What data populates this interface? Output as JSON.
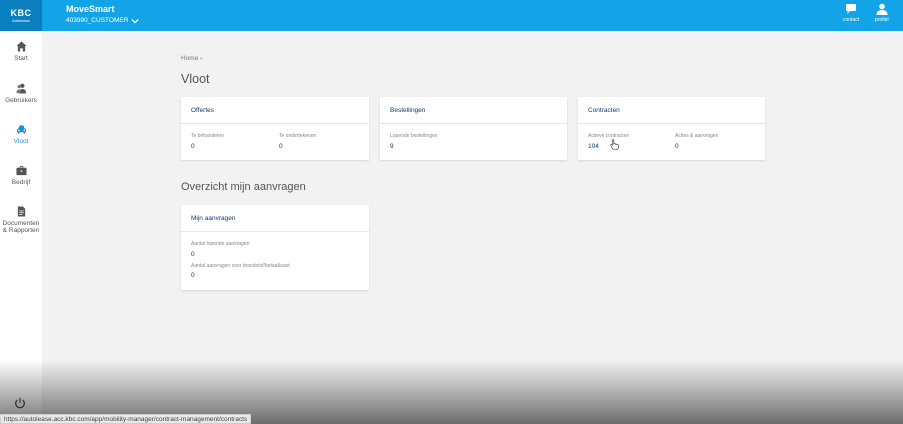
{
  "header": {
    "logo_text": "KBC",
    "logo_sub": "Autolease",
    "app_title": "MoveSmart",
    "customer": "403990_CUSTOMER",
    "contact_label": "contact",
    "profile_label": "profiel",
    "bar_color": "#12a4e6"
  },
  "sidebar": {
    "items": [
      {
        "label": "Start",
        "icon": "home-icon"
      },
      {
        "label": "Gebruikers",
        "icon": "users-icon"
      },
      {
        "label": "Vloot",
        "icon": "car-icon",
        "active": true
      },
      {
        "label": "Bedrijf",
        "icon": "briefcase-icon"
      },
      {
        "label": "Documenten & Rapporten",
        "icon": "document-icon"
      }
    ],
    "power_icon": "power-icon"
  },
  "main": {
    "breadcrumb": "Home  ›",
    "title": "Vloot",
    "cards": {
      "offertes": {
        "title": "Offertes",
        "metrics": [
          {
            "label": "Te behandelen",
            "value": "0"
          },
          {
            "label": "Te ondertekenen",
            "value": "0"
          }
        ]
      },
      "bestellingen": {
        "title": "Bestellingen",
        "metrics": [
          {
            "label": "Lopende bestellingen",
            "value": "9"
          }
        ]
      },
      "contracten": {
        "title": "Contracten",
        "metrics": [
          {
            "label": "Actieve contracten",
            "value": "104"
          },
          {
            "label": "Acties & aanvragen",
            "value": "0"
          }
        ]
      }
    },
    "section_title": "Overzicht mijn aanvragen",
    "requests_card": {
      "title": "Mijn aanvragen",
      "metrics": [
        {
          "label": "Aantal lopende aanvragen",
          "value": "0"
        },
        {
          "label": "Aantal aanvragen voor brandstof/betaalkaart",
          "value": "0"
        }
      ]
    }
  },
  "status_bar": {
    "url": "https://autolease.acc.kbc.com/app/mobility-manager/contract-management/contracts"
  },
  "colors": {
    "accent": "#1a8fd6",
    "value_text": "#0d3b6a",
    "background": "#f2f2f2"
  }
}
